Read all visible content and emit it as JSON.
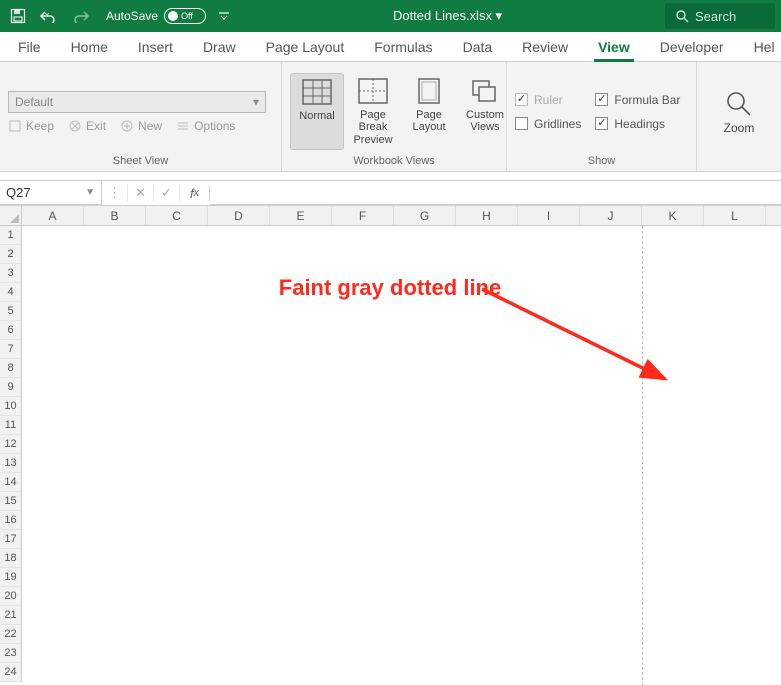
{
  "titlebar": {
    "autosave_label": "AutoSave",
    "autosave_state": "Off",
    "filename": "Dotted Lines.xlsx ▾",
    "search_placeholder": "Search"
  },
  "tabs": [
    "File",
    "Home",
    "Insert",
    "Draw",
    "Page Layout",
    "Formulas",
    "Data",
    "Review",
    "View",
    "Developer",
    "Hel"
  ],
  "active_tab": "View",
  "ribbon": {
    "sheet_view": {
      "combo_value": "Default",
      "keep": "Keep",
      "exit": "Exit",
      "new": "New",
      "options": "Options",
      "group_label": "Sheet View"
    },
    "workbook_views": {
      "items": [
        {
          "label": "Normal",
          "active": true
        },
        {
          "label": "Page Break Preview",
          "active": false
        },
        {
          "label": "Page Layout",
          "active": false
        },
        {
          "label": "Custom Views",
          "active": false
        }
      ],
      "group_label": "Workbook Views"
    },
    "show": {
      "ruler": {
        "label": "Ruler",
        "checked": true,
        "disabled": true
      },
      "gridlines": {
        "label": "Gridlines",
        "checked": false,
        "disabled": false
      },
      "formula_bar": {
        "label": "Formula Bar",
        "checked": true,
        "disabled": false
      },
      "headings": {
        "label": "Headings",
        "checked": true,
        "disabled": false
      },
      "group_label": "Show"
    },
    "zoom": {
      "label": "Zoom"
    }
  },
  "formula_bar": {
    "name_box": "Q27",
    "formula": ""
  },
  "grid": {
    "columns": [
      "A",
      "B",
      "C",
      "D",
      "E",
      "F",
      "G",
      "H",
      "I",
      "J",
      "K",
      "L"
    ],
    "rows": [
      1,
      2,
      3,
      4,
      5,
      6,
      7,
      8,
      9,
      10,
      11,
      12,
      13,
      14,
      15,
      16,
      17,
      18,
      19,
      20,
      21,
      22,
      23,
      24
    ],
    "page_break_after_col_index": 10
  },
  "annotation": {
    "text": "Faint gray dotted line"
  },
  "colors": {
    "brand": "#107C41",
    "annotation": "#ff2a1a"
  }
}
